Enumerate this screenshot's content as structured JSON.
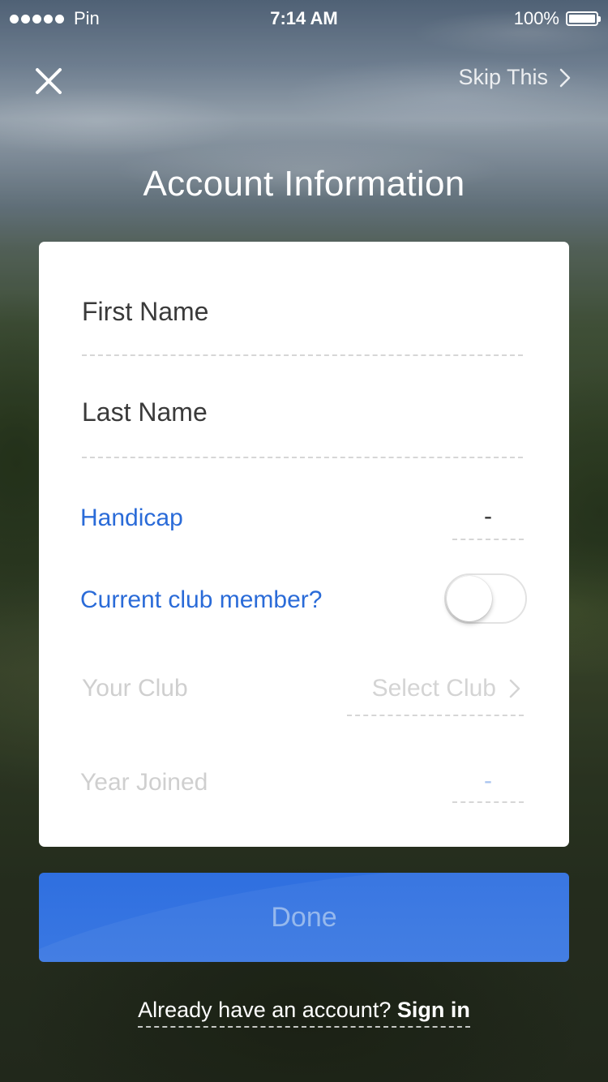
{
  "status_bar": {
    "carrier": "Pin",
    "time": "7:14 AM",
    "battery": "100%"
  },
  "nav": {
    "close_icon": "close-icon",
    "skip_label": "Skip This",
    "skip_icon": "chevron-right-icon"
  },
  "page_title": "Account Information",
  "form": {
    "first_name": {
      "placeholder": "First Name",
      "value": ""
    },
    "last_name": {
      "placeholder": "Last Name",
      "value": ""
    },
    "handicap": {
      "label": "Handicap",
      "value": "-"
    },
    "club_member": {
      "label": "Current club member?",
      "toggle_on": false
    },
    "your_club": {
      "label": "Your Club",
      "value": "Select Club"
    },
    "year_joined": {
      "label": "Year Joined",
      "value": "-"
    }
  },
  "done_label": "Done",
  "signin": {
    "prompt": "Already have an account?",
    "link": "Sign in"
  },
  "colors": {
    "accent": "#2a6bd8",
    "button": "#3373e0",
    "card": "#ffffff"
  }
}
